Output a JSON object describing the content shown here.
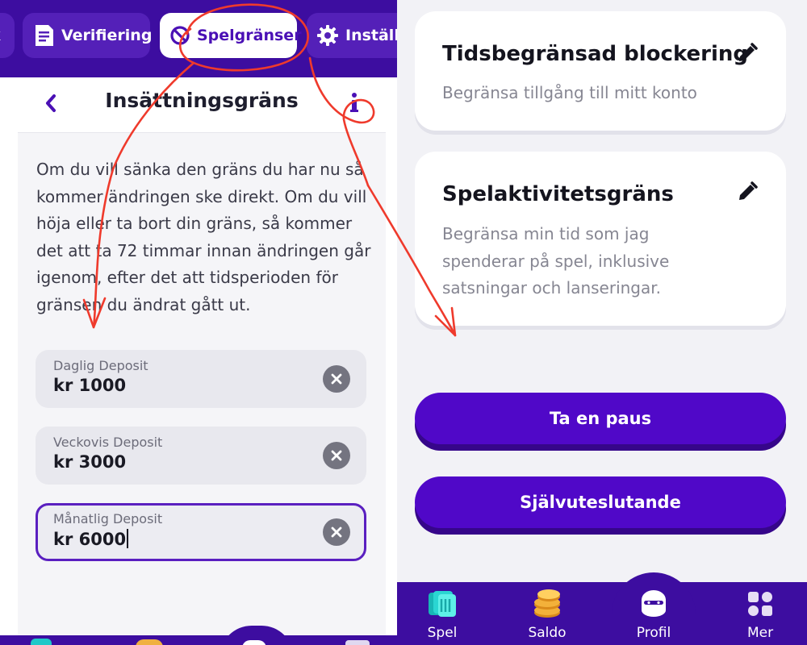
{
  "left_panel": {
    "nav_tabs": [
      {
        "label": "k",
        "icon": "partial-tab"
      },
      {
        "label": "Verifiering",
        "icon": "document-icon"
      },
      {
        "label": "Spelgränser",
        "icon": "limits-icon",
        "active": true
      },
      {
        "label": "Inställn",
        "icon": "gear-icon"
      }
    ],
    "header": {
      "title": "Insättningsgräns",
      "back_icon": "chevron-left-icon",
      "info_icon": "info-icon"
    },
    "description": "Om du vill sänka den gräns du har nu så kommer ändringen ske direkt. Om du vill höja eller ta bort din gräns, så kommer det att ta 72 timmar innan ändringen går igenom, efter det att tidsperioden för gränsen du ändrat gått ut.",
    "fields": [
      {
        "label": "Daglig Deposit",
        "value": "kr 1000",
        "focused": false
      },
      {
        "label": "Veckovis Deposit",
        "value": "kr 3000",
        "focused": false
      },
      {
        "label": "Månatlig Deposit",
        "value": "kr 6000",
        "focused": true
      }
    ]
  },
  "right_panel": {
    "cards": [
      {
        "title": "Tidsbegränsad blockering",
        "description": "Begränsa tillgång till mitt konto",
        "icon": "pencil-icon"
      },
      {
        "title": "Spelaktivitetsgräns",
        "description": "Begränsa min tid som jag spenderar på spel, inklusive satsningar och lanseringar.",
        "icon": "pencil-icon"
      }
    ],
    "buttons": {
      "pause": "Ta en paus",
      "self_exclusion": "Självuteslutande"
    },
    "tabbar": [
      {
        "label": "Spel",
        "icon": "games-icon"
      },
      {
        "label": "Saldo",
        "icon": "coins-icon"
      },
      {
        "label": "Profil",
        "icon": "avatar-icon",
        "active": true
      },
      {
        "label": "Mer",
        "icon": "grid-icon"
      }
    ]
  },
  "colors": {
    "brand_purple": "#3d0da0",
    "button_purple": "#5008c8",
    "annotation_red": "#ef3a2c",
    "teal": "#1fc8c8",
    "gold": "#f0b040"
  }
}
